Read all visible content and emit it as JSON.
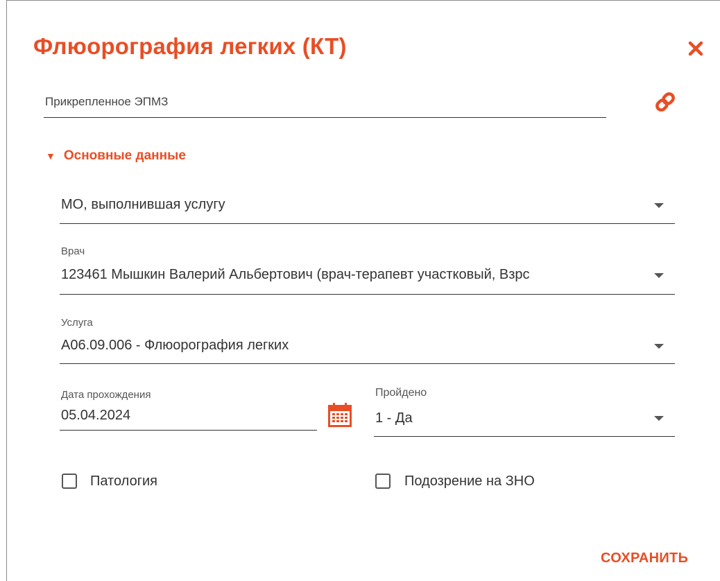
{
  "dialog": {
    "title": "Флюорография легких (КТ)",
    "close_icon": "close-icon",
    "accent_color": "#e84e25"
  },
  "attached": {
    "label": "Прикрепленное ЭПМЗ",
    "link_icon": "link-icon"
  },
  "section": {
    "title": "Основные данные",
    "expanded": true
  },
  "fields": {
    "mo": {
      "placeholder": "МО, выполнившая услугу",
      "value": ""
    },
    "doctor": {
      "label": "Врач",
      "value": "123461 Мышкин Валерий Альбертович (врач-терапевт участковый, Взрс"
    },
    "service": {
      "label": "Услуга",
      "value": "A06.09.006 - Флюорография легких"
    },
    "date": {
      "label": "Дата прохождения",
      "value": "05.04.2024",
      "icon": "calendar-icon"
    },
    "passed": {
      "label": "Пройдено",
      "value": "1 - Да"
    }
  },
  "checkboxes": {
    "pathology": {
      "label": "Патология",
      "checked": false
    },
    "zno": {
      "label": "Подозрение на ЗНО",
      "checked": false
    }
  },
  "actions": {
    "save_label": "СОХРАНИТЬ"
  }
}
